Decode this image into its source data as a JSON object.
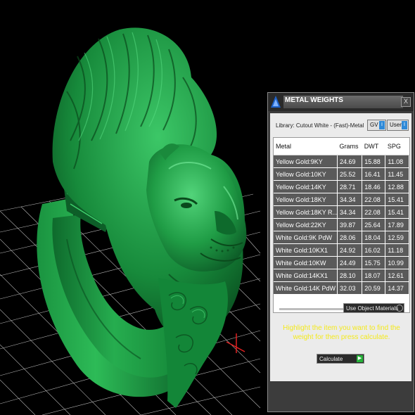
{
  "panel": {
    "title": "METAL WEIGHTS",
    "close_label": "X",
    "library": "Library: Cutout White - (Fast)-Metal",
    "gv_label": "GV",
    "user_label": "User",
    "columns": [
      "Metal",
      "Grams",
      "DWT",
      "SPG"
    ],
    "rows": [
      [
        "Yellow Gold:9KY",
        "24.69",
        "15.88",
        "11.08"
      ],
      [
        "Yellow Gold:10KY",
        "25.52",
        "16.41",
        "11.45"
      ],
      [
        "Yellow Gold:14KY",
        "28.71",
        "18.46",
        "12.88"
      ],
      [
        "Yellow Gold:18KY",
        "34.34",
        "22.08",
        "15.41"
      ],
      [
        "Yellow Gold:18KY R...",
        "34.34",
        "22.08",
        "15.41"
      ],
      [
        "Yellow Gold:22KY",
        "39.87",
        "25.64",
        "17.89"
      ],
      [
        "White Gold:9K PdW",
        "28.06",
        "18.04",
        "12.59"
      ],
      [
        "White Gold:10KX1",
        "24.92",
        "16.02",
        "11.18"
      ],
      [
        "White Gold:10KW",
        "24.49",
        "15.75",
        "10.99"
      ],
      [
        "White Gold:14KX1",
        "28.10",
        "18.07",
        "12.61"
      ],
      [
        "White Gold:14K PdW",
        "32.03",
        "20.59",
        "14.37"
      ]
    ],
    "use_object_materials": "Use Object Materials",
    "hint": "Highlight the item you want to find the weight for then press calculate.",
    "calculate_label": "Calculate"
  },
  "colors": {
    "ring_green": "#1fa044",
    "grid_white": "#ffffff",
    "hint_yellow": "#f4ea1c",
    "row_bg": "#5a5a5a"
  },
  "icons": {
    "logo": "app-logo-icon",
    "close": "close-icon",
    "go": "arrow-right-icon"
  }
}
